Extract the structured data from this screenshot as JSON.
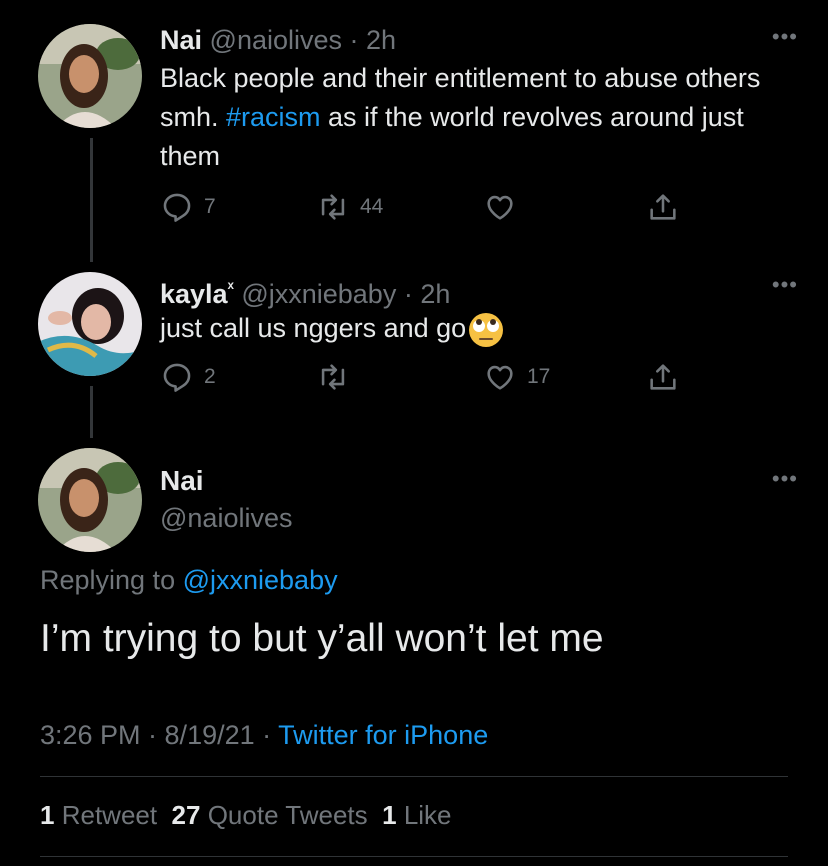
{
  "tweets": [
    {
      "name": "Nai",
      "handle": "@naiolives",
      "time": "· 2h",
      "text_before": "Black people and their entitlement to abuse others smh. ",
      "hashtag": "#racism",
      "text_after": " as if the world revolves around just them",
      "replies": "7",
      "retweets": "44",
      "likes": ""
    },
    {
      "name": "kayla",
      "name_suffix": "ˣ",
      "handle": "@jxxniebaby",
      "time": "· 2h",
      "text": "just call us nggers and go",
      "emoji": "🙄",
      "replies": "2",
      "retweets": "",
      "likes": "17"
    }
  ],
  "main_tweet": {
    "name": "Nai",
    "handle": "@naiolives",
    "replying_prefix": "Replying to ",
    "replying_to": "@jxxniebaby",
    "text": "I’m trying to but y’all won’t let me",
    "timestamp": "3:26 PM · 8/19/21 · ",
    "source": "Twitter for iPhone"
  },
  "stats": {
    "retweets_count": "1",
    "retweets_label": "Retweet",
    "quotes_count": "27",
    "quotes_label": "Quote Tweets",
    "likes_count": "1",
    "likes_label": "Like"
  },
  "more_label": "•••",
  "colors": {
    "accent": "#1d9bf0",
    "muted": "#71767b",
    "text": "#e7e9ea",
    "background": "#000000"
  }
}
